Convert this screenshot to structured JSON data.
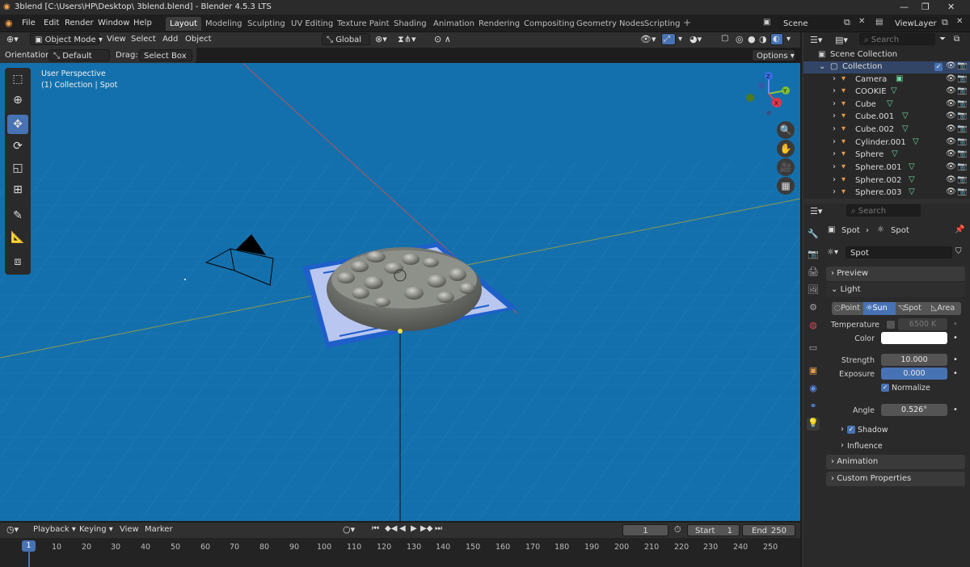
{
  "window": {
    "title": "3blend [C:\\Users\\HP\\Desktop\\ 3blend.blend] - Blender 4.5.3 LTS"
  },
  "menu": [
    "File",
    "Edit",
    "Render",
    "Window",
    "Help"
  ],
  "workspaces": [
    "Layout",
    "Modeling",
    "Sculpting",
    "UV Editing",
    "Texture Paint",
    "Shading",
    "Animation",
    "Rendering",
    "Compositing",
    "Geometry Nodes",
    "Scripting"
  ],
  "scene": {
    "name": "Scene",
    "view_layer": "ViewLayer"
  },
  "viewport_header": {
    "mode": "Object Mode",
    "view": "View",
    "select": "Select",
    "add": "Add",
    "object": "Object",
    "transform": "Global",
    "options": "Options"
  },
  "tool_settings": {
    "orientation_label": "Orientation:",
    "orientation": "Default",
    "drag_label": "Drag:",
    "drag": "Select Box"
  },
  "viewport": {
    "perspective": "User Perspective",
    "context": "(1) Collection | Spot",
    "gizmo": {
      "x": "X",
      "y": "Y",
      "z": "Z"
    }
  },
  "outliner": {
    "search_placeholder": "Search",
    "scene_collection": "Scene Collection",
    "collection": "Collection",
    "items": [
      "Camera",
      "COOKIE",
      "Cube",
      "Cube.001",
      "Cube.002",
      "Cylinder.001",
      "Sphere",
      "Sphere.001",
      "Sphere.002",
      "Sphere.003"
    ]
  },
  "properties": {
    "search_placeholder": "Search",
    "breadcrumb_object": "Spot",
    "breadcrumb_data": "Spot",
    "datablock": "Spot",
    "preview": "Preview",
    "light": "Light",
    "light_types": [
      "Point",
      "Sun",
      "Spot",
      "Area"
    ],
    "temperature_label": "Temperature",
    "temperature": "6500 K",
    "color_label": "Color",
    "color": "#ffffff",
    "strength_label": "Strength",
    "strength": "10.000",
    "exposure_label": "Exposure",
    "exposure": "0.000",
    "normalize": "Normalize",
    "angle_label": "Angle",
    "angle": "0.526°",
    "shadow": "Shadow",
    "influence": "Influence",
    "animation": "Animation",
    "custom_properties": "Custom Properties"
  },
  "timeline": {
    "playback": "Playback",
    "keying": "Keying",
    "view": "View",
    "marker": "Marker",
    "current_frame": "1",
    "start_label": "Start",
    "start": "1",
    "end_label": "End",
    "end": "250",
    "ticks": [
      "1",
      "10",
      "20",
      "30",
      "40",
      "50",
      "60",
      "70",
      "80",
      "90",
      "100",
      "110",
      "120",
      "130",
      "140",
      "150",
      "160",
      "170",
      "180",
      "190",
      "200",
      "210",
      "220",
      "230",
      "240",
      "250"
    ]
  },
  "colors": {
    "accent": "#4772b3",
    "viewport_bg": "#1470ac",
    "outliner_icon": "#e59a4b",
    "mesh_data": "#6fd7a0"
  }
}
